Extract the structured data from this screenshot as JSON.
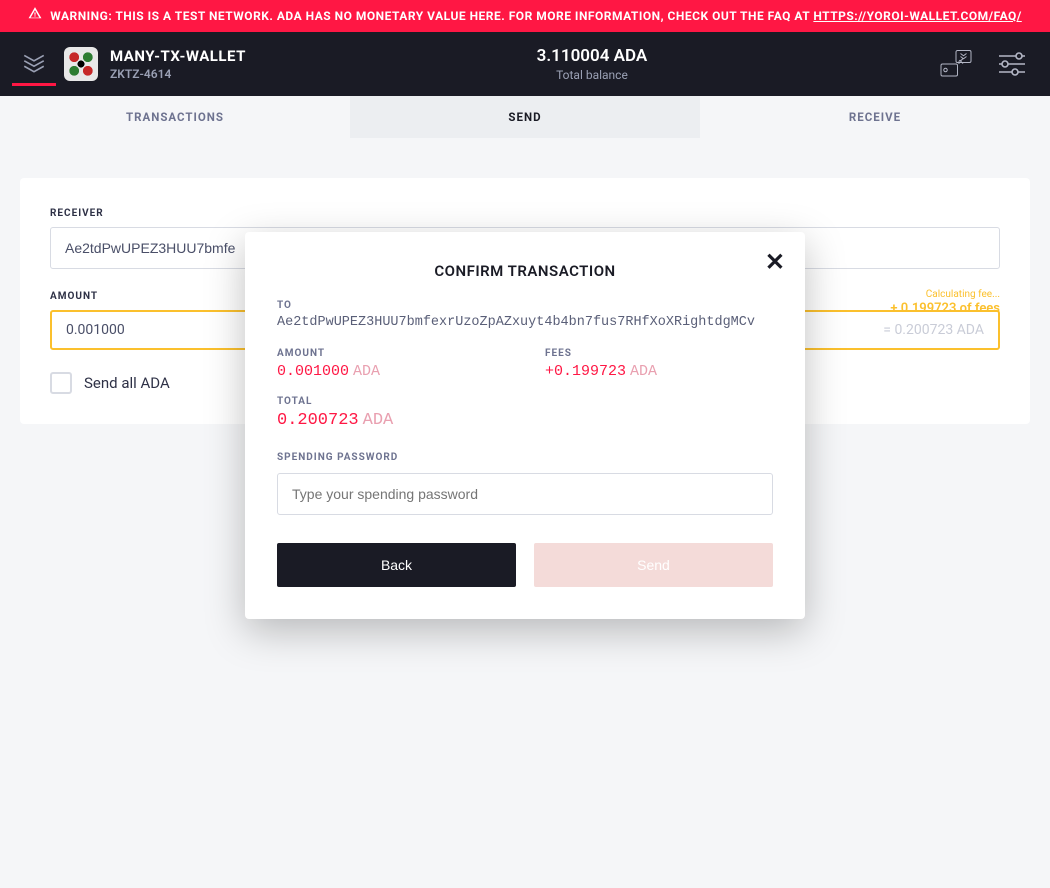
{
  "warning": {
    "text": "WARNING: THIS IS A TEST NETWORK. ADA HAS NO MONETARY VALUE HERE. FOR MORE INFORMATION, CHECK OUT THE FAQ AT ",
    "link_text": "HTTPS://YOROI-WALLET.COM/FAQ/"
  },
  "header": {
    "wallet_name": "MANY-TX-WALLET",
    "wallet_subtitle": "ZKTZ-4614",
    "balance_value": "3.110004 ADA",
    "balance_label": "Total balance"
  },
  "tabs": {
    "transactions": "TRANSACTIONS",
    "send": "SEND",
    "receive": "RECEIVE"
  },
  "send_form": {
    "receiver_label": "RECEIVER",
    "receiver_value": "Ae2tdPwUPEZ3HUU7bmfe",
    "amount_label": "AMOUNT",
    "amount_value": "0.001000",
    "fee_note_line1": "Calculating fee...",
    "fee_note_line2": "+ 0.199723 of fees",
    "amount_suffix": "= 0.200723 ADA",
    "send_all_label": "Send all ADA"
  },
  "modal": {
    "title": "CONFIRM TRANSACTION",
    "to_label": "TO",
    "to_address": "Ae2tdPwUPEZ3HUU7bmfexrUzoZpAZxuyt4b4bn7fus7RHfXoXRightdgMCv",
    "amount_label": "AMOUNT",
    "amount_value": "0.001000",
    "fees_label": "FEES",
    "fees_value": "+0.199723",
    "total_label": "TOTAL",
    "total_value": "0.200723",
    "unit": "ADA",
    "password_label": "SPENDING PASSWORD",
    "password_placeholder": "Type your spending password",
    "back_label": "Back",
    "send_label": "Send"
  }
}
